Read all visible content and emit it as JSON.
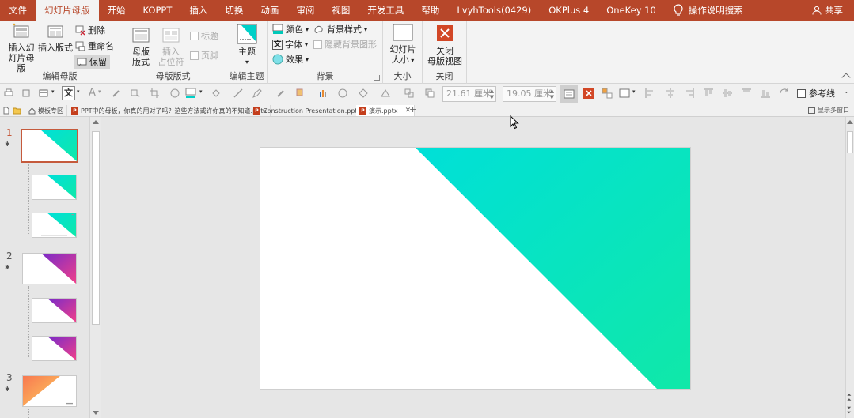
{
  "menu": {
    "tabs": [
      "文件",
      "幻灯片母版",
      "开始",
      "KOPPT",
      "插入",
      "切换",
      "动画",
      "审阅",
      "视图",
      "开发工具",
      "帮助",
      "LvyhTools(0429)",
      "OKPlus 4",
      "OneKey 10"
    ],
    "active_tab": "幻灯片母版",
    "tell_me": "操作说明搜索",
    "share": "共享"
  },
  "ribbon": {
    "edit_master": {
      "label": "编辑母版",
      "insert_slide_master_l1": "插入幻",
      "insert_slide_master_l2": "灯片母版",
      "insert_layout": "插入版式",
      "delete": "删除",
      "rename": "重命名",
      "preserve": "保留"
    },
    "master_layout": {
      "label": "母版版式",
      "master_layout_l1": "母版",
      "master_layout_l2": "版式",
      "insert_placeholder_l1": "插入",
      "insert_placeholder_l2": "占位符",
      "title": "标题",
      "footer": "页脚"
    },
    "edit_theme": {
      "label": "编辑主题",
      "themes": "主题"
    },
    "background": {
      "label": "背景",
      "colors": "颜色",
      "fonts": "字体",
      "effects": "效果",
      "bg_styles": "背景样式",
      "hide_bg": "隐藏背景图形"
    },
    "size": {
      "label": "大小",
      "slide_size_l1": "幻灯片",
      "slide_size_l2": "大小"
    },
    "close": {
      "label": "关闭",
      "close_l1": "关闭",
      "close_l2": "母版视图"
    }
  },
  "toolbar": {
    "width": "21.61 厘米",
    "height": "19.05 厘米",
    "guides": "参考线"
  },
  "doc_tabs": [
    {
      "label": "模板专区",
      "active": false
    },
    {
      "label": "PPT中的母板，你真的用对了吗？这些方法或许你真的不知道.pptx",
      "active": false
    },
    {
      "label": "Construction Presentation.pptx",
      "active": false
    },
    {
      "label": "演示.pptx",
      "active": true
    }
  ],
  "doc_tabs_right": "显示多窗口",
  "slides": {
    "numbers": [
      "1",
      "2",
      "3"
    ]
  },
  "colors": {
    "accent": "#b7472a",
    "teal_start": "#00e0d8",
    "teal_end": "#10e8a8",
    "purple_start": "#7a2bc8",
    "purple_end": "#f0408a",
    "orange_start": "#f87850",
    "orange_end": "#fcd060"
  }
}
